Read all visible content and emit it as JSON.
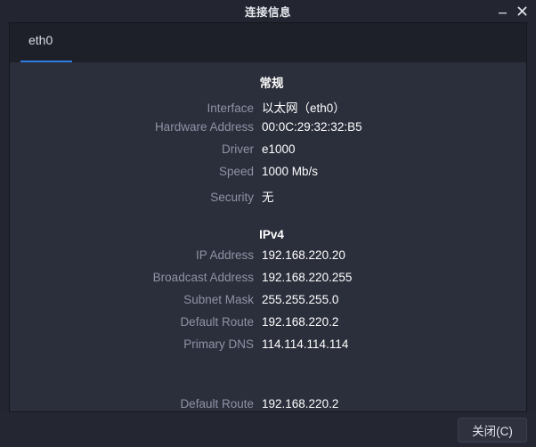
{
  "window": {
    "title": "连接信息",
    "controls": {
      "minimize": "minimize-icon",
      "close": "close-icon"
    }
  },
  "tabs": [
    {
      "label": "eth0",
      "active": true
    }
  ],
  "accent_color": "#2f7de0",
  "sections": [
    {
      "heading": "常规",
      "rows": [
        {
          "label": "Interface",
          "value": "以太网（eth0）"
        },
        {
          "label": "Hardware Address",
          "value": "00:0C:29:32:32:B5"
        },
        {
          "label": "Driver",
          "value": "e1000"
        },
        {
          "label": "Speed",
          "value": "1000 Mb/s"
        },
        {
          "label": "Security",
          "value": "无"
        }
      ]
    },
    {
      "heading": "IPv4",
      "rows": [
        {
          "label": "IP Address",
          "value": "192.168.220.20"
        },
        {
          "label": "Broadcast Address",
          "value": "192.168.220.255"
        },
        {
          "label": "Subnet Mask",
          "value": "255.255.255.0"
        },
        {
          "label": "Default Route",
          "value": "192.168.220.2"
        },
        {
          "label": "Primary DNS",
          "value": "114.114.114.114"
        }
      ]
    },
    {
      "heading": "",
      "rows": [
        {
          "label": "Default Route",
          "value": "192.168.220.2"
        }
      ]
    }
  ],
  "footer": {
    "close_label": "关闭(C)"
  }
}
